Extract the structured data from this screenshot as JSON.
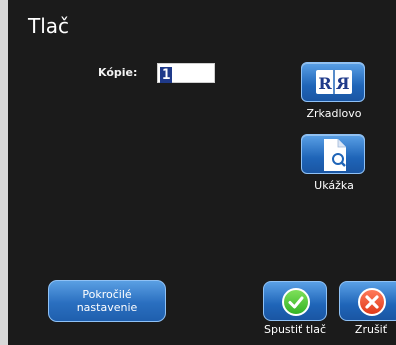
{
  "window": {
    "title": "Tlač"
  },
  "copies": {
    "label": "Kópie:",
    "value": "1"
  },
  "tools": {
    "mirror_label": "Zrkadlovo",
    "preview_label": "Ukážka"
  },
  "buttons": {
    "advanced_label": "Pokročilé nastavenie",
    "start_label": "Spustiť tlač",
    "cancel_label": "Zrušiť"
  },
  "icons": {
    "mirror": "mirror-r-icon",
    "preview": "document-magnifier-icon",
    "start": "checkmark-icon",
    "cancel": "x-icon"
  },
  "colors": {
    "background": "#1b1b1b",
    "button_blue": "#1f65b8",
    "ok_green": "#34b325",
    "cancel_red": "#e03a1a"
  }
}
